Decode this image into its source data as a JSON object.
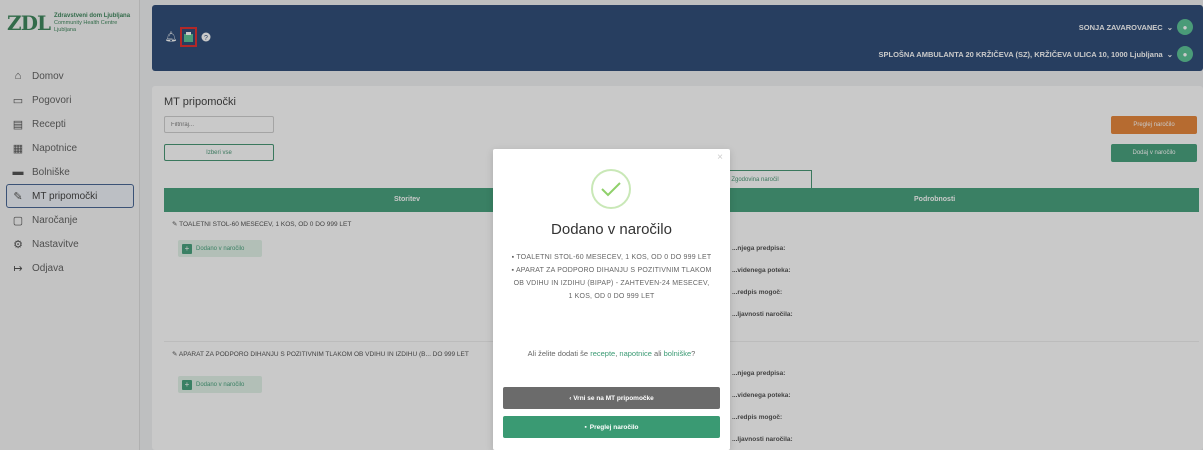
{
  "logo": {
    "title": "Zdravstveni dom Ljubljana",
    "subtitle": "Community Health Centre Ljubljana"
  },
  "sidebar": {
    "items": [
      {
        "label": "Domov",
        "icon": "home-icon"
      },
      {
        "label": "Pogovori",
        "icon": "chat-icon"
      },
      {
        "label": "Recepti",
        "icon": "prescription-icon"
      },
      {
        "label": "Napotnice",
        "icon": "referral-icon"
      },
      {
        "label": "Bolniške",
        "icon": "bed-icon"
      },
      {
        "label": "MT pripomočki",
        "icon": "wrench-icon",
        "active": true
      },
      {
        "label": "Naročanje",
        "icon": "calendar-icon"
      },
      {
        "label": "Nastavitve",
        "icon": "gear-icon"
      },
      {
        "label": "Odjava",
        "icon": "logout-icon"
      }
    ]
  },
  "header": {
    "user_name": "SONJA ZAVAROVANEC",
    "location": "SPLOŠNA AMBULANTA 20 KRŽIČEVA (SZ), KRŽIČEVA ULICA 10, 1000 Ljubljana",
    "icons": [
      "bell-icon",
      "cart-icon",
      "help-icon"
    ]
  },
  "main": {
    "title": "MT pripomočki",
    "filter_placeholder": "Filtriraj...",
    "select_all_label": "Izberi vse",
    "review_order_label": "Preglej naročilo",
    "add_to_order_label": "Dodaj v naročilo",
    "history_tab_label": "Zgodovina naročil",
    "table": {
      "col_service": "Storitev",
      "col_details": "Podrobnosti",
      "rows": [
        {
          "title": "TOALETNI STOL-60 MESECEV, 1 KOS, OD 0 DO 999 LET",
          "added_label": "Dodano v naročilo",
          "details": [
            "...njega predpisa:",
            "...videnega poteka:",
            "...redpis mogoč:",
            "...ljavnosti naročila:"
          ]
        },
        {
          "title": "APARAT ZA PODPORO DIHANJU S POZITIVNIM TLAKOM OB VDIHU IN IZDIHU (B... DO 999 LET",
          "added_label": "Dodano v naročilo",
          "details": [
            "...njega predpisa:",
            "...videnega poteka:",
            "...redpis mogoč:",
            "...ljavnosti naročila:"
          ]
        }
      ]
    }
  },
  "modal": {
    "title": "Dodano v naročilo",
    "items": [
      "TOALETNI STOL-60 MESECEV, 1 KOS, OD 0 DO 999 LET",
      "APARAT ZA PODPORO DIHANJU S POZITIVNIM TLAKOM OB VDIHU IN IZDIHU (BIPAP) - ZAHTEVEN-24 MESECEV, 1 KOS, OD 0 DO 999 LET"
    ],
    "question_prefix": "Ali želite dodati še",
    "link_recepti": "recepte",
    "link_napotnice": "napotnice",
    "question_mid": "ali",
    "link_bolniske": "bolniške",
    "question_end": "?",
    "back_button": "‹ Vrni se na MT pripomočke",
    "review_button": "Preglej naročilo"
  },
  "colors": {
    "navy": "#1f3f6e",
    "green": "#3a9a73",
    "orange": "#e57d2b"
  }
}
